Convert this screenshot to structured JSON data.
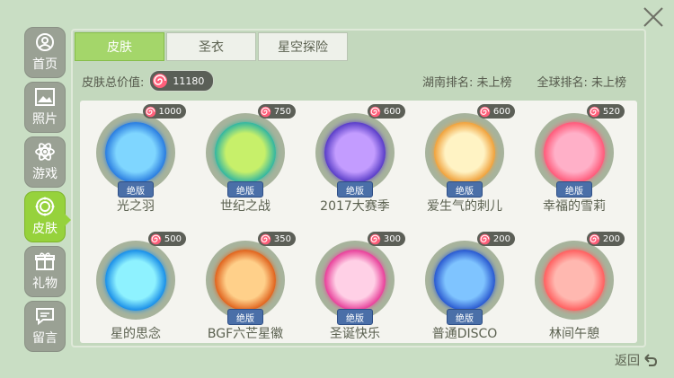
{
  "close": {
    "icon": "close-icon"
  },
  "sidebar": {
    "items": [
      {
        "label": "首页",
        "icon": "profile-icon",
        "active": false
      },
      {
        "label": "照片",
        "icon": "photo-icon",
        "active": false
      },
      {
        "label": "游戏",
        "icon": "atom-icon",
        "active": false
      },
      {
        "label": "皮肤",
        "icon": "skin-ring-icon",
        "active": true
      },
      {
        "label": "礼物",
        "icon": "gift-icon",
        "active": false
      },
      {
        "label": "留言",
        "icon": "message-icon",
        "active": false
      }
    ]
  },
  "tabs": [
    {
      "label": "皮肤",
      "active": true
    },
    {
      "label": "圣衣",
      "active": false
    },
    {
      "label": "星空探险",
      "active": false
    }
  ],
  "info": {
    "total_label": "皮肤总价值:",
    "total_value": "11180",
    "hunan_rank": "湖南排名: 未上榜",
    "global_rank": "全球排名: 未上榜"
  },
  "skins": [
    {
      "name": "光之羽",
      "price": "1000",
      "badge": "绝版",
      "colors": [
        "#7fd6ff",
        "#2a7de0"
      ]
    },
    {
      "name": "世纪之战",
      "price": "750",
      "badge": "绝版",
      "colors": [
        "#c7f06a",
        "#33b6a0"
      ]
    },
    {
      "name": "2017大赛季",
      "price": "600",
      "badge": "绝版",
      "colors": [
        "#c39cff",
        "#5a3ec8"
      ]
    },
    {
      "name": "爱生气的刺儿",
      "price": "600",
      "badge": "绝版",
      "colors": [
        "#fff3c4",
        "#f0a23c"
      ]
    },
    {
      "name": "幸福的雪莉",
      "price": "520",
      "badge": "绝版",
      "colors": [
        "#ffb0c8",
        "#ff5a7a"
      ]
    },
    {
      "name": "星的思念",
      "price": "500",
      "badge": "",
      "colors": [
        "#8ef2ff",
        "#1a8fe8"
      ]
    },
    {
      "name": "BGF六芒星徽",
      "price": "350",
      "badge": "绝版",
      "colors": [
        "#ffd08a",
        "#e0641e"
      ]
    },
    {
      "name": "圣诞快乐",
      "price": "300",
      "badge": "绝版",
      "colors": [
        "#ffd0e6",
        "#e8409a"
      ]
    },
    {
      "name": "普通DISCO",
      "price": "200",
      "badge": "绝版",
      "colors": [
        "#7fc4ff",
        "#2a5ad0"
      ]
    },
    {
      "name": "林间午憩",
      "price": "200",
      "badge": "",
      "colors": [
        "#ffb8b0",
        "#ff6060"
      ]
    }
  ],
  "back": {
    "label": "返回",
    "icon": "back-arrow-icon"
  }
}
